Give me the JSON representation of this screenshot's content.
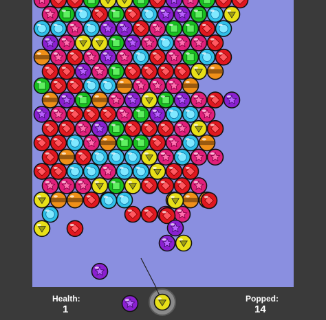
{
  "hud": {
    "health_label": "Health:",
    "health_value": "1",
    "popped_label": "Popped:",
    "popped_value": "14"
  },
  "colors": {
    "background": "#3a3a3a",
    "playfield": "#8a8fe0",
    "red": "#e01820",
    "green": "#18c020",
    "blue": "#30c0e8",
    "magenta": "#e0207a",
    "purple": "#8a20d0",
    "yellow": "#e8e018",
    "orange": "#f09018"
  },
  "bubble_legend": {
    "r": "red-gem",
    "g": "green-square",
    "b": "blue-circle",
    "m": "magenta-star",
    "p": "purple-star",
    "y": "yellow-triangle",
    "o": "orange-stripe"
  },
  "grid": [
    "mrrgyygrpmgrr",
    "mgbrgrbppgby",
    "bbmbpprmggrb",
    "pmyygpmbmmr",
    "omrmpmbrmgbr",
    "rrpmgrrrryo",
    "grrbbommmo",
    "opgompygpmrp",
    "pmrrrmgpbbm",
    "rrmpgrrrmyr",
    "rrbmoggrmbo",
    "rorbbbymbmm",
    "rrbbmbbyrr",
    "mmmygyrrrm",
    "yooryb..ooo",
    "b....rrmm..",
    "y.r........",
    "..........",
    "..........",
    "...p......."
  ],
  "grid_extra": [
    {
      "c": "y",
      "row": 14,
      "col": 0
    }
  ],
  "loose_bubbles": [
    "b",
    "r",
    "y",
    "r",
    "r",
    "p",
    "p",
    "y"
  ],
  "shooter": {
    "current_bubble": "y",
    "next_bubble": "p",
    "aim_angle_deg": -32
  }
}
